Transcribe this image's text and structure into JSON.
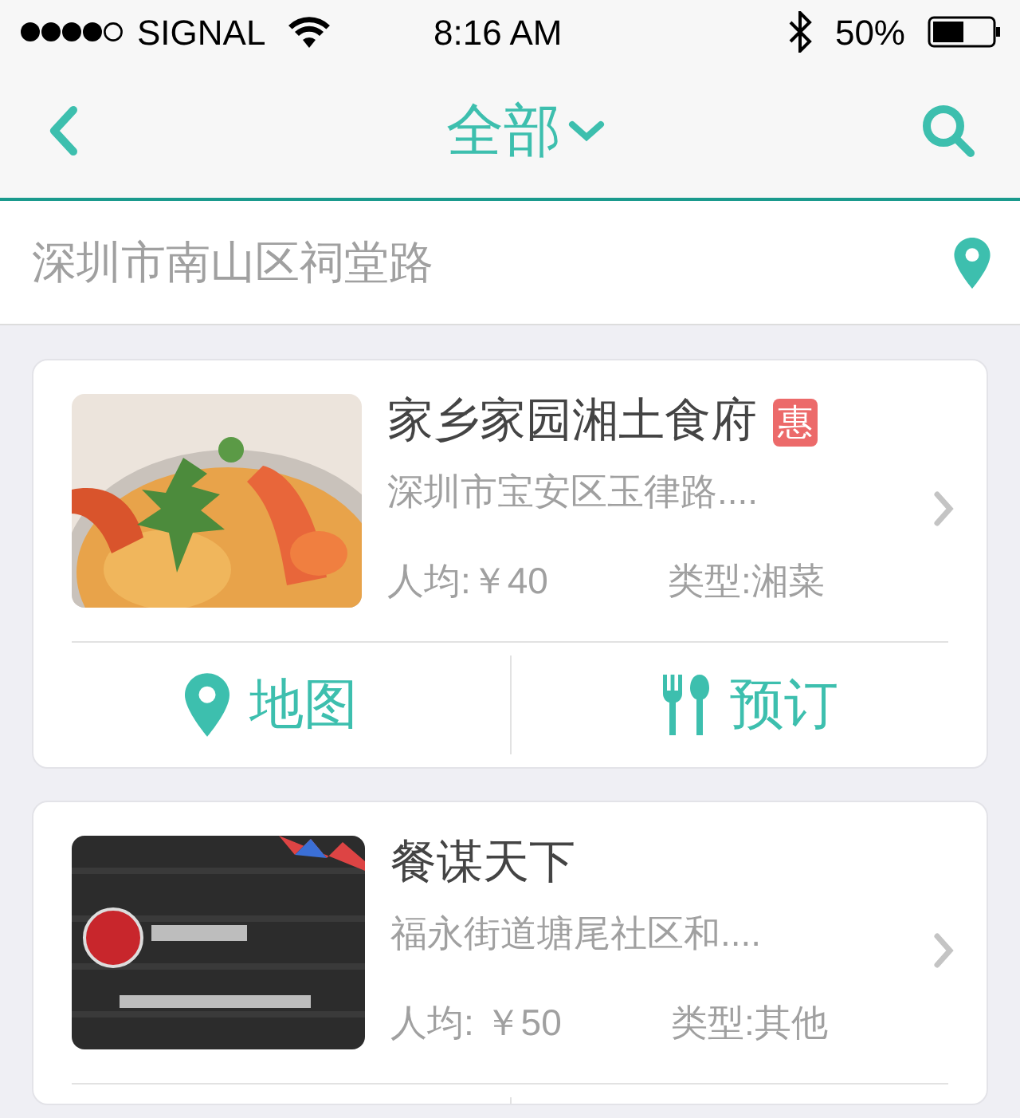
{
  "status_bar": {
    "carrier": "SIGNAL",
    "time": "8:16 AM",
    "battery": "50%"
  },
  "nav_bar": {
    "title": "全部"
  },
  "location_bar": {
    "address": "深圳市南山区祠堂路"
  },
  "restaurants": [
    {
      "name": "家乡家园湘土食府",
      "badge": "惠",
      "address": "深圳市宝安区玉律路....",
      "price": "人均:￥40",
      "category": "类型:湘菜",
      "actions": [
        {
          "kind": "map",
          "label": "地图"
        },
        {
          "kind": "booking",
          "label": "预订"
        }
      ]
    },
    {
      "name": "餐谋天下",
      "address": "福永街道塘尾社区和....",
      "price": "人均: ￥50",
      "category": "类型:其他"
    }
  ]
}
